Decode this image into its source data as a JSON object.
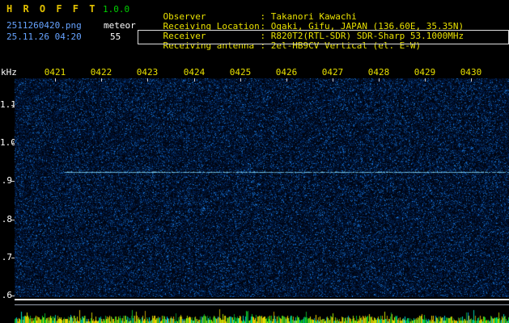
{
  "app": {
    "title": "H R O F F T",
    "version": "1.0.0",
    "filename": "2511260420.png",
    "mode": "meteor",
    "datetime": "25.11.26 04:20",
    "count": "55"
  },
  "info": {
    "rows": [
      {
        "label": "Observer",
        "value": ": Takanori Kawachi"
      },
      {
        "label": "Receiving Location",
        "value": ": Ogaki, Gifu, JAPAN (136.60E, 35.35N)"
      },
      {
        "label": "Receiver",
        "value": ": R820T2(RTL-SDR) SDR-Sharp 53.1000MHz"
      },
      {
        "label": "Receiving antenna",
        "value": ": 2el-HB9CV Vertical (el. E-W)"
      }
    ]
  },
  "spectrogram": {
    "unit_label": "kHz"
  },
  "chart_data": {
    "type": "heatmap",
    "x_tick_labels": [
      "0421",
      "0422",
      "0423",
      "0424",
      "0425",
      "0426",
      "0427",
      "0428",
      "0429",
      "0430"
    ],
    "y_tick_labels": [
      "1.1",
      "1.0",
      ".9",
      ".8",
      ".7",
      ".6"
    ],
    "ylabel": "kHz",
    "ylim": [
      0.57,
      1.17
    ],
    "carrier_line_khz": 0.93,
    "note": "dark blue random-noise spectrogram; continuous narrow carrier line at ~0.93 kHz running from 0421 to 0430; bottom strip shows white baseline lines over yellow/green per-second signal-level bars"
  },
  "colors": {
    "title-gold": "#e2c000",
    "yellow": "#e8e000",
    "green": "#00d000",
    "blue-text": "#66a3ff",
    "white": "#ffffff",
    "signal-cyan": "#7fd8ff",
    "tick": "#cccccc",
    "box-border": "#dddddd"
  }
}
